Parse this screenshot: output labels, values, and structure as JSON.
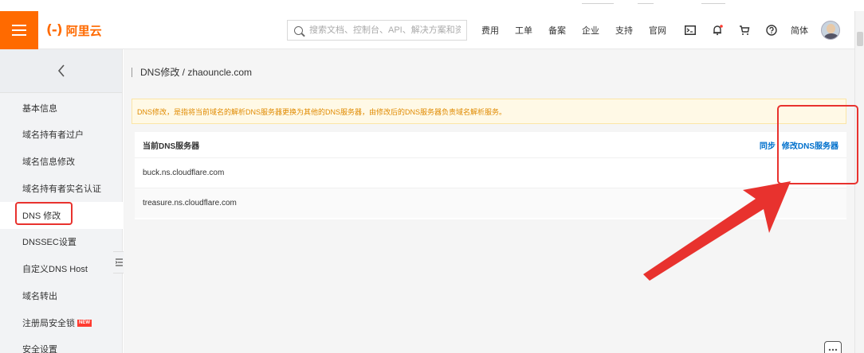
{
  "header": {
    "logo_bracket": "(-)",
    "logo_text": "阿里云",
    "search_placeholder": "搜索文档、控制台、API、解决方案和资源",
    "nav_items": [
      "费用",
      "工单",
      "备案",
      "企业",
      "支持",
      "官网"
    ],
    "lang": "简体"
  },
  "sidebar": {
    "items": [
      {
        "label": "基本信息"
      },
      {
        "label": "域名持有者过户"
      },
      {
        "label": "域名信息修改"
      },
      {
        "label": "域名持有者实名认证"
      },
      {
        "label": "DNS 修改"
      },
      {
        "label": "DNSSEC设置"
      },
      {
        "label": "自定义DNS Host"
      },
      {
        "label": "域名转出"
      },
      {
        "label": "注册局安全锁",
        "badge": "NEW"
      },
      {
        "label": "安全设置"
      }
    ],
    "active_index": 4
  },
  "main": {
    "title": "DNS修改 / zhaouncle.com",
    "notice": "DNS修改，是指将当前域名的解析DNS服务器更换为其他的DNS服务器，由修改后的DNS服务器负责域名解析服务。",
    "panel_title": "当前DNS服务器",
    "action_sync": "同步",
    "action_modify": "修改DNS服务器",
    "dns_servers": [
      "buck.ns.cloudflare.com",
      "treasure.ns.cloudflare.com"
    ]
  },
  "colors": {
    "brand": "#ff6a00",
    "link": "#0070cc",
    "annotation": "#e8322e",
    "notice_text": "#e08a00",
    "notice_bg": "#fff9e6"
  },
  "icons": [
    "menu-icon",
    "search-icon",
    "terminal-icon",
    "bell-icon",
    "cart-icon",
    "help-icon",
    "chevron-left-icon",
    "collapse-icon",
    "chat-icon"
  ]
}
